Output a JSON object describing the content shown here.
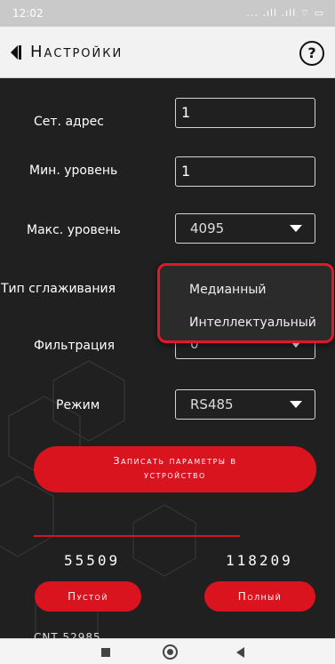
{
  "status_bar": {
    "time": "12:02",
    "icons": "... .ıll .ıll ⌔ ▭"
  },
  "app_bar": {
    "title": "Настройки",
    "help_label": "?"
  },
  "form": {
    "net_address": {
      "label": "Сет. адрес",
      "value": "1"
    },
    "min_level": {
      "label": "Мин. уровень",
      "value": "1"
    },
    "max_level": {
      "label": "Макс. уровень",
      "value": "4095"
    },
    "smoothing": {
      "label": "Тип сглаживания",
      "options": [
        "Медианный",
        "Интеллектуальный"
      ]
    },
    "filtration": {
      "label": "Фильтрация",
      "value": "0"
    },
    "mode": {
      "label": "Режим",
      "value": "RS485"
    }
  },
  "write_button": {
    "line1": "Записать параметры в",
    "line2": "устройство"
  },
  "readings": {
    "empty_value": "55509",
    "full_value": "118209"
  },
  "buttons": {
    "empty_label": "Пустой",
    "full_label": "Полный"
  },
  "cnt": {
    "text": "CNT 52985"
  },
  "colors": {
    "accent": "#d9141f",
    "highlight": "#e2182a",
    "background": "#202020"
  }
}
